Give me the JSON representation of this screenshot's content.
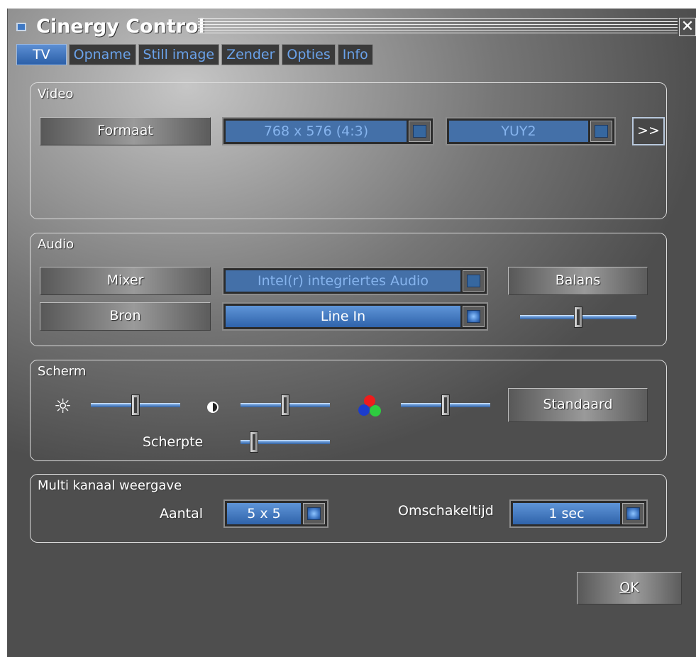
{
  "window": {
    "title": "Cinergy Control",
    "close_symbol": "✕"
  },
  "tabs": [
    {
      "label": "TV",
      "active": true
    },
    {
      "label": "Opname",
      "active": false
    },
    {
      "label": "Still image",
      "active": false
    },
    {
      "label": "Zender",
      "active": false
    },
    {
      "label": "Opties",
      "active": false
    },
    {
      "label": "Info",
      "active": false
    }
  ],
  "video": {
    "group_label": "Video",
    "format_button": "Formaat",
    "resolution_value": "768 x 576 (4:3)",
    "colorspace_value": "YUY2",
    "more_button": ">>"
  },
  "audio": {
    "group_label": "Audio",
    "mixer_button": "Mixer",
    "mixer_value": "Intel(r) integriertes Audio",
    "source_button": "Bron",
    "source_value": "Line In",
    "balance_button": "Balans",
    "balance_level": 0.5
  },
  "screen": {
    "group_label": "Scherm",
    "icons": [
      "sun-icon",
      "contrast-icon",
      "rgb-color-icon"
    ],
    "brightness_level": 0.5,
    "contrast_level": 0.5,
    "color_level": 0.5,
    "default_button": "Standaard",
    "sharpness_label": "Scherpte",
    "sharpness_level": 0.15
  },
  "multi_channel": {
    "group_label": "Multi kanaal weergave",
    "count_label": "Aantal",
    "count_value": "5 x 5",
    "switch_time_label": "Omschakeltijd",
    "switch_time_value": "1 sec"
  },
  "footer": {
    "ok_accel": "O",
    "ok_rest": "K"
  },
  "colors": {
    "accent": "#4a80c8",
    "tab_text": "#6aa2ea",
    "red": "#ee1c1c",
    "green": "#2ecc40",
    "blue": "#1c3ccc"
  }
}
